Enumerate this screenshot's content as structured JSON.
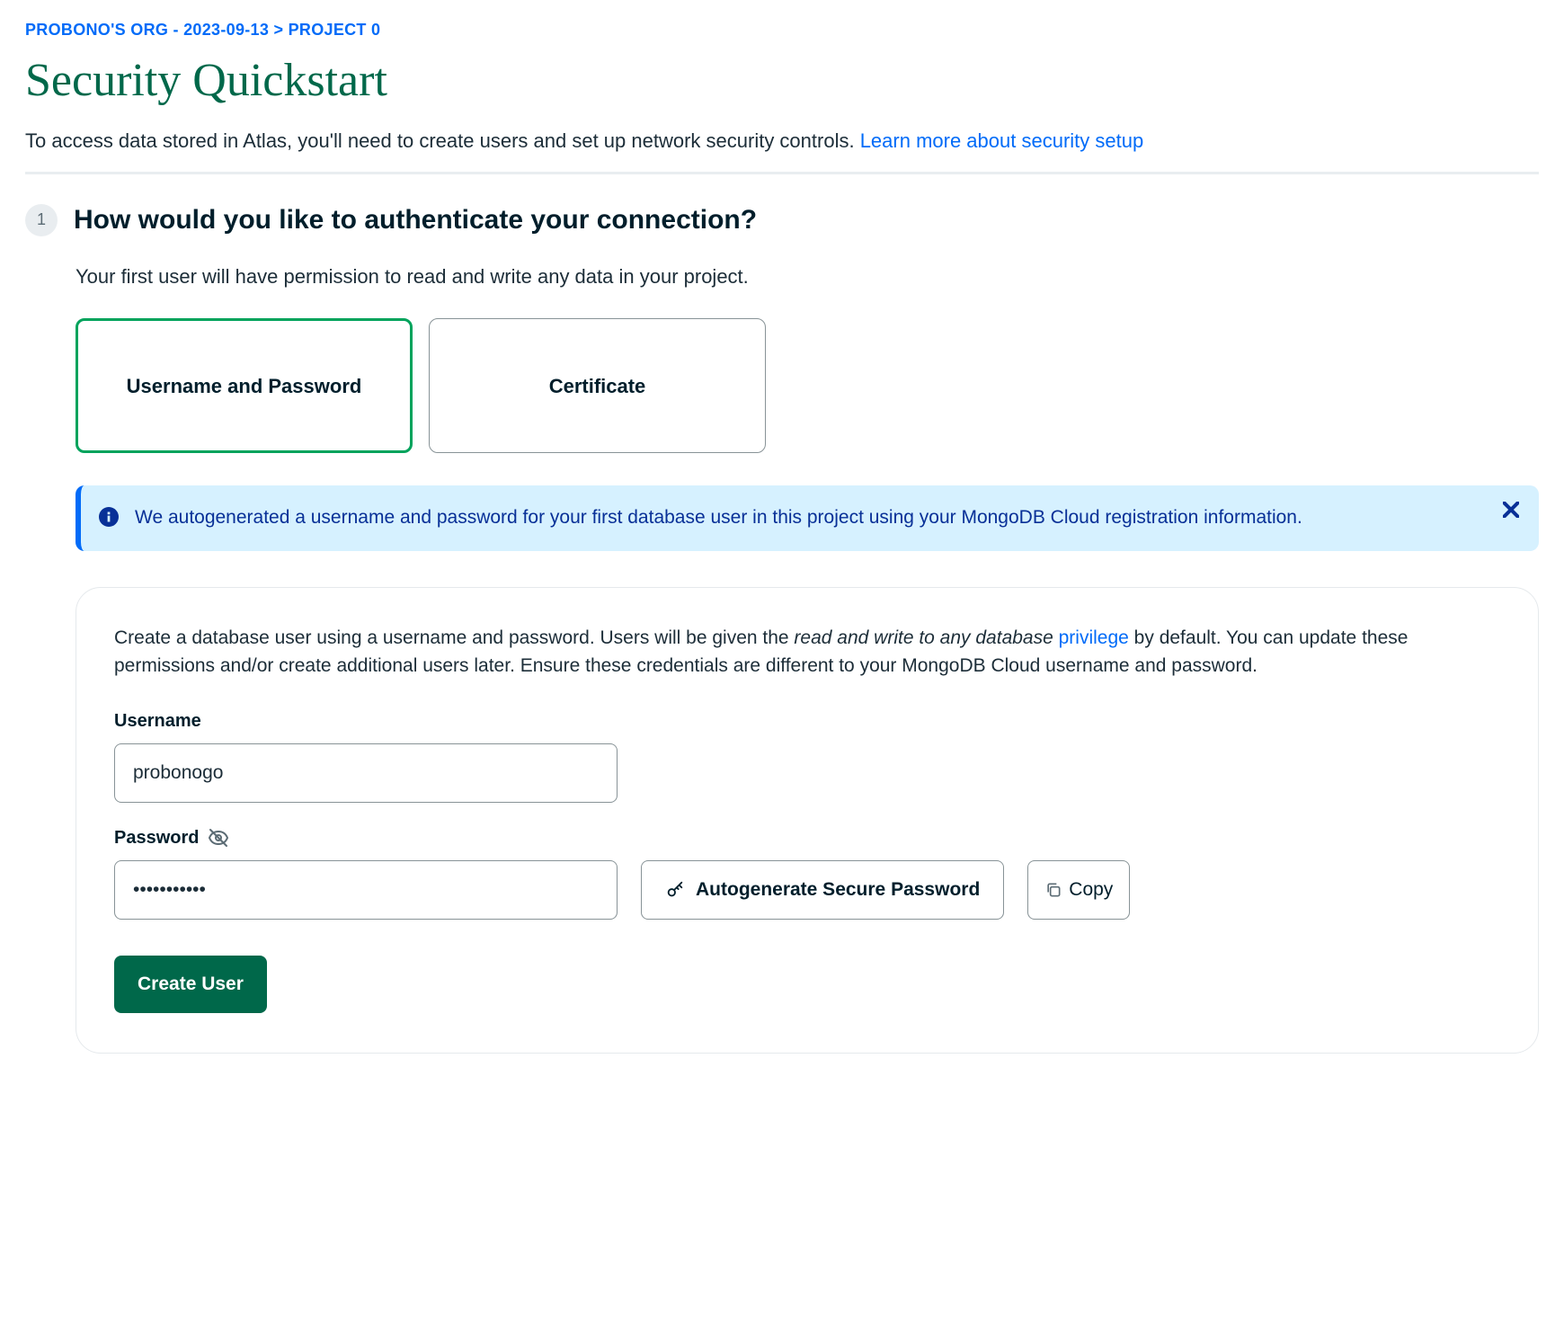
{
  "breadcrumb": {
    "org": "PROBONO'S ORG - 2023-09-13",
    "sep": ">",
    "project": "PROJECT 0"
  },
  "page_title": "Security Quickstart",
  "subtitle": {
    "text": "To access data stored in Atlas, you'll need to create users and set up network security controls. ",
    "link": "Learn more about security setup"
  },
  "step1": {
    "num": "1",
    "title": "How would you like to authenticate your connection?",
    "desc": "Your first user will have permission to read and write any data in your project.",
    "options": {
      "username_password": "Username and Password",
      "certificate": "Certificate"
    }
  },
  "banner": {
    "msg": "We autogenerated a username and password for your first database user in this project using your MongoDB Cloud registration information."
  },
  "card": {
    "desc_before": "Create a database user using a username and password. Users will be given the ",
    "desc_ital": "read and write to any database ",
    "desc_link": "privilege",
    "desc_after": " by default. You can update these permissions and/or create additional users later. Ensure these credentials are different to your MongoDB Cloud username and password.",
    "username_label": "Username",
    "username_value": "probonogo",
    "password_label": "Password",
    "password_value": "•••••••••••",
    "autogen_btn": "Autogenerate Secure Password",
    "copy_btn": "Copy",
    "create_btn": "Create User"
  }
}
